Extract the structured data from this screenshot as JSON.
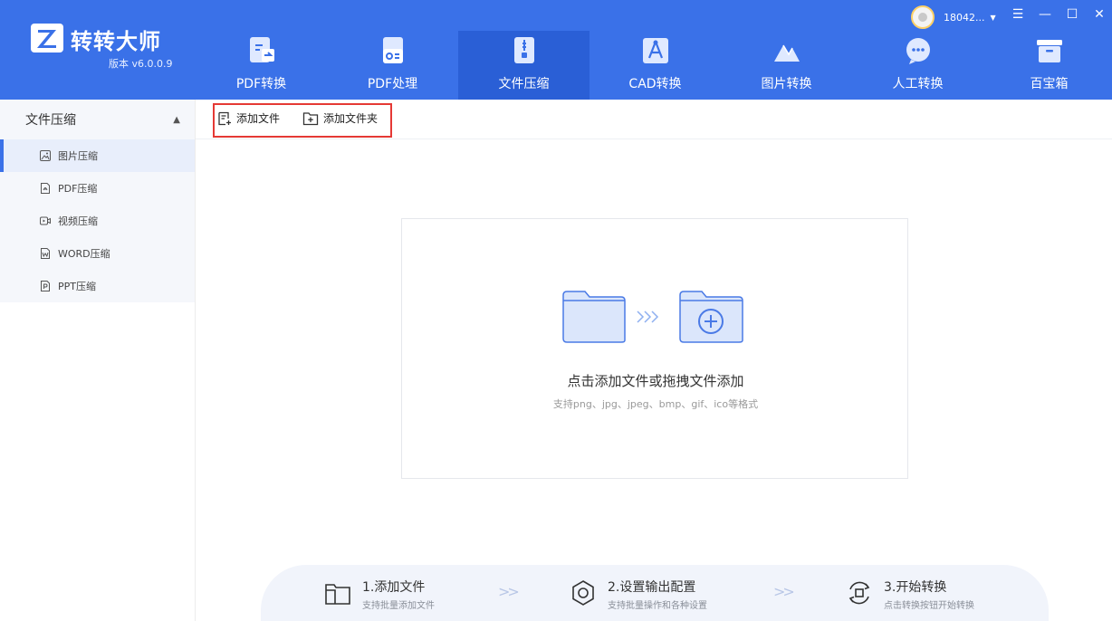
{
  "app": {
    "logo_text": "转转大师",
    "version": "版本 v6.0.0.9"
  },
  "user": {
    "name": "18042..."
  },
  "nav": [
    {
      "label": "PDF转换",
      "icon": "pdf-convert-icon"
    },
    {
      "label": "PDF处理",
      "icon": "pdf-process-icon"
    },
    {
      "label": "文件压缩",
      "icon": "file-compress-icon"
    },
    {
      "label": "CAD转换",
      "icon": "cad-convert-icon"
    },
    {
      "label": "图片转换",
      "icon": "image-convert-icon"
    },
    {
      "label": "人工转换",
      "icon": "manual-convert-icon"
    },
    {
      "label": "百宝箱",
      "icon": "toolbox-icon"
    }
  ],
  "active_nav": "文件压缩",
  "sidebar": {
    "section_title": "文件压缩",
    "items": [
      {
        "label": "图片压缩",
        "icon": "image-icon"
      },
      {
        "label": "PDF压缩",
        "icon": "pdf-icon"
      },
      {
        "label": "视频压缩",
        "icon": "video-icon"
      },
      {
        "label": "WORD压缩",
        "icon": "word-icon"
      },
      {
        "label": "PPT压缩",
        "icon": "ppt-icon"
      }
    ],
    "active_item": "图片压缩"
  },
  "toolbar": {
    "add_file": "添加文件",
    "add_folder": "添加文件夹"
  },
  "dropzone": {
    "title": "点击添加文件或拖拽文件添加",
    "subtitle": "支持png、jpg、jpeg、bmp、gif、ico等格式"
  },
  "steps": [
    {
      "title": "1.添加文件",
      "sub": "支持批量添加文件"
    },
    {
      "title": "2.设置输出配置",
      "sub": "支持批量操作和各种设置"
    },
    {
      "title": "3.开始转换",
      "sub": "点击转换按钮开始转换"
    }
  ],
  "colors": {
    "brand": "#3a71e8",
    "nav_active": "#2a5fd6",
    "highlight_box": "#e53935"
  }
}
